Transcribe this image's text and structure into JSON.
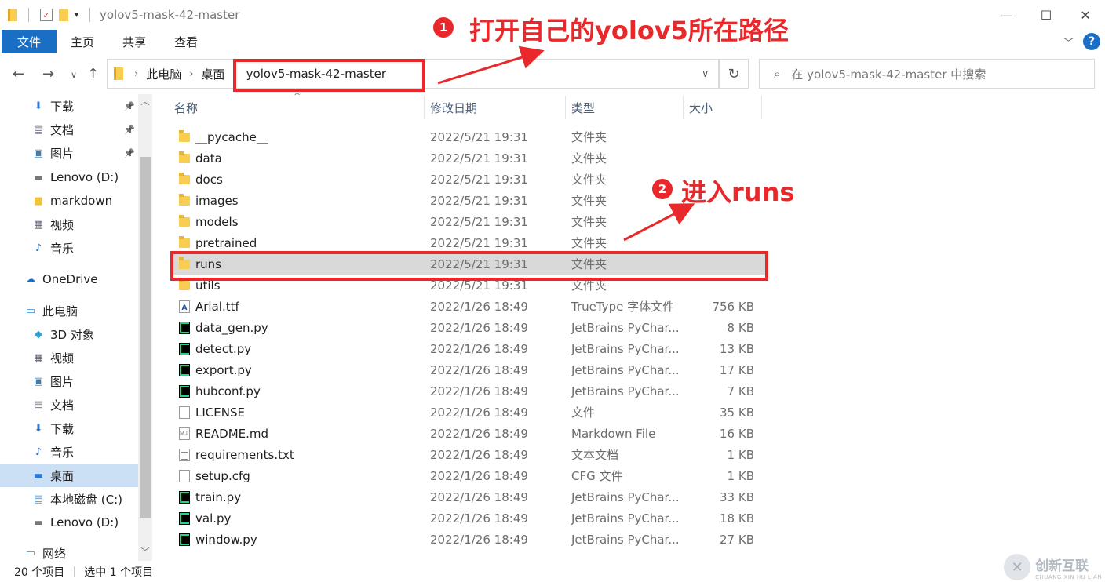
{
  "window": {
    "title": "yolov5-mask-42-master",
    "controls": [
      "minimize-icon",
      "maximize-icon",
      "close-icon"
    ]
  },
  "ribbon": {
    "tabs": [
      {
        "label": "文件",
        "active": true
      },
      {
        "label": "主页"
      },
      {
        "label": "共享"
      },
      {
        "label": "查看"
      }
    ]
  },
  "address": {
    "crumbs": [
      "此电脑",
      "桌面",
      "yolov5-mask-42-master"
    ],
    "search_placeholder": "在 yolov5-mask-42-master 中搜索"
  },
  "sidebar": {
    "items": [
      {
        "label": "下载",
        "icon": "download-icon",
        "pinned": true
      },
      {
        "label": "文档",
        "icon": "document-icon",
        "pinned": true
      },
      {
        "label": "图片",
        "icon": "pictures-icon",
        "pinned": true
      },
      {
        "label": "Lenovo (D:)",
        "icon": "drive-icon"
      },
      {
        "label": "markdown",
        "icon": "folder-icon"
      },
      {
        "label": "视频",
        "icon": "video-icon"
      },
      {
        "label": "音乐",
        "icon": "music-icon"
      },
      {
        "label": "OneDrive",
        "icon": "cloud-icon"
      },
      {
        "label": "此电脑",
        "icon": "computer-icon"
      },
      {
        "label": "3D 对象",
        "icon": "3d-objects-icon"
      },
      {
        "label": "视频",
        "icon": "video-icon"
      },
      {
        "label": "图片",
        "icon": "pictures-icon"
      },
      {
        "label": "文档",
        "icon": "document-icon"
      },
      {
        "label": "下载",
        "icon": "download-icon"
      },
      {
        "label": "音乐",
        "icon": "music-icon"
      },
      {
        "label": "桌面",
        "icon": "desktop-icon",
        "selected": true
      },
      {
        "label": "本地磁盘 (C:)",
        "icon": "windows-drive-icon"
      },
      {
        "label": "Lenovo (D:)",
        "icon": "drive-icon"
      },
      {
        "label": "网络",
        "icon": "network-icon"
      }
    ]
  },
  "columns": {
    "name": "名称",
    "date": "修改日期",
    "type": "类型",
    "size": "大小"
  },
  "files": [
    {
      "name": "__pycache__",
      "date": "2022/5/21 19:31",
      "type": "文件夹",
      "size": "",
      "icon": "folder"
    },
    {
      "name": "data",
      "date": "2022/5/21 19:31",
      "type": "文件夹",
      "size": "",
      "icon": "folder"
    },
    {
      "name": "docs",
      "date": "2022/5/21 19:31",
      "type": "文件夹",
      "size": "",
      "icon": "folder"
    },
    {
      "name": "images",
      "date": "2022/5/21 19:31",
      "type": "文件夹",
      "size": "",
      "icon": "folder"
    },
    {
      "name": "models",
      "date": "2022/5/21 19:31",
      "type": "文件夹",
      "size": "",
      "icon": "folder"
    },
    {
      "name": "pretrained",
      "date": "2022/5/21 19:31",
      "type": "文件夹",
      "size": "",
      "icon": "folder"
    },
    {
      "name": "runs",
      "date": "2022/5/21 19:31",
      "type": "文件夹",
      "size": "",
      "icon": "folder",
      "selected": true
    },
    {
      "name": "utils",
      "date": "2022/5/21 19:31",
      "type": "文件夹",
      "size": "",
      "icon": "folder"
    },
    {
      "name": "Arial.ttf",
      "date": "2022/1/26 18:49",
      "type": "TrueType 字体文件",
      "size": "756 KB",
      "icon": "ttf"
    },
    {
      "name": "data_gen.py",
      "date": "2022/1/26 18:49",
      "type": "JetBrains PyChar...",
      "size": "8 KB",
      "icon": "py"
    },
    {
      "name": "detect.py",
      "date": "2022/1/26 18:49",
      "type": "JetBrains PyChar...",
      "size": "13 KB",
      "icon": "py"
    },
    {
      "name": "export.py",
      "date": "2022/1/26 18:49",
      "type": "JetBrains PyChar...",
      "size": "17 KB",
      "icon": "py"
    },
    {
      "name": "hubconf.py",
      "date": "2022/1/26 18:49",
      "type": "JetBrains PyChar...",
      "size": "7 KB",
      "icon": "py"
    },
    {
      "name": "LICENSE",
      "date": "2022/1/26 18:49",
      "type": "文件",
      "size": "35 KB",
      "icon": "doc"
    },
    {
      "name": "README.md",
      "date": "2022/1/26 18:49",
      "type": "Markdown File",
      "size": "16 KB",
      "icon": "md"
    },
    {
      "name": "requirements.txt",
      "date": "2022/1/26 18:49",
      "type": "文本文档",
      "size": "1 KB",
      "icon": "txt"
    },
    {
      "name": "setup.cfg",
      "date": "2022/1/26 18:49",
      "type": "CFG 文件",
      "size": "1 KB",
      "icon": "doc"
    },
    {
      "name": "train.py",
      "date": "2022/1/26 18:49",
      "type": "JetBrains PyChar...",
      "size": "33 KB",
      "icon": "py"
    },
    {
      "name": "val.py",
      "date": "2022/1/26 18:49",
      "type": "JetBrains PyChar...",
      "size": "18 KB",
      "icon": "py"
    },
    {
      "name": "window.py",
      "date": "2022/1/26 18:49",
      "type": "JetBrains PyChar...",
      "size": "27 KB",
      "icon": "py"
    }
  ],
  "status": {
    "item_count": "20 个项目",
    "selected": "选中 1 个项目"
  },
  "annotations": {
    "step1_num": "1",
    "step1_text": "打开自己的yolov5所在路径",
    "step2_num": "2",
    "step2_text": "进入runs",
    "color": "#e8282a"
  },
  "watermark": {
    "cn": "创新互联",
    "en": "CHUANG XIN HU LIAN"
  }
}
